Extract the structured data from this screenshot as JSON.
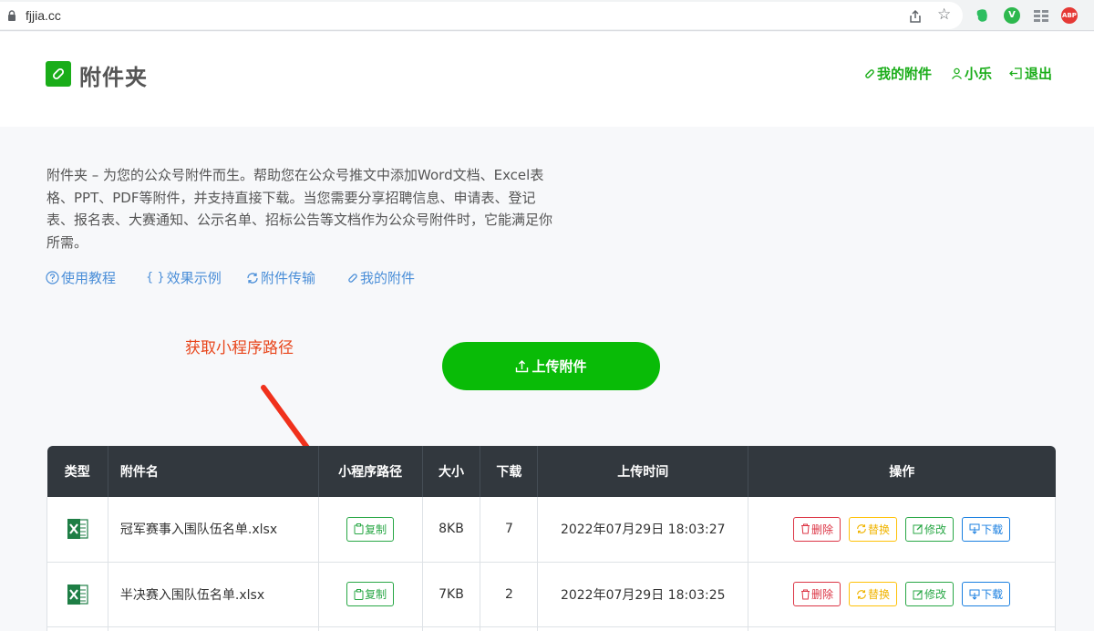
{
  "browser": {
    "url": "fjjia.cc",
    "icons": [
      "lock-icon",
      "share-icon",
      "star-icon",
      "evernote-icon",
      "vimium-icon",
      "grid-icon",
      "abp-icon"
    ],
    "vimium_label": "V",
    "abp_label": "ABP"
  },
  "header": {
    "title": "附件夹",
    "nav": {
      "my_files": "我的附件",
      "user": "小乐",
      "logout": "退出"
    }
  },
  "intro": {
    "text": "附件夹 – 为您的公众号附件而生。帮助您在公众号推文中添加Word文档、Excel表格、PPT、PDF等附件，并支持直接下载。当您需要分享招聘信息、申请表、登记表、报名表、大赛通知、公示名单、招标公告等文档作为公众号附件时，它能满足你所需。",
    "links": {
      "tutorial": "使用教程",
      "examples": "效果示例",
      "transfer": "附件传输",
      "my_files": "我的附件"
    }
  },
  "annotation": {
    "text": "获取小程序路径"
  },
  "upload": {
    "label": "上传附件"
  },
  "table": {
    "headers": {
      "type": "类型",
      "name": "附件名",
      "path": "小程序路径",
      "size": "大小",
      "downloads": "下载",
      "upload_time": "上传时间",
      "actions": "操作"
    },
    "rows": [
      {
        "type_icon": "excel-icon",
        "name": "冠军赛事入围队伍名单.xlsx",
        "copy": "复制",
        "size": "8KB",
        "downloads": "7",
        "upload_time": "2022年07月29日 18:03:27"
      },
      {
        "type_icon": "excel-icon",
        "name": "半决赛入围队伍名单.xlsx",
        "copy": "复制",
        "size": "7KB",
        "downloads": "2",
        "upload_time": "2022年07月29日 18:03:25"
      }
    ],
    "actions": {
      "delete": "删除",
      "replace": "替换",
      "edit": "修改",
      "download": "下载"
    }
  },
  "colors": {
    "brand_green": "#1aad19",
    "upload_green": "#09bb07",
    "link_blue": "#4a8ed8",
    "annotation_red": "#e8461c",
    "table_header": "#32383e"
  }
}
